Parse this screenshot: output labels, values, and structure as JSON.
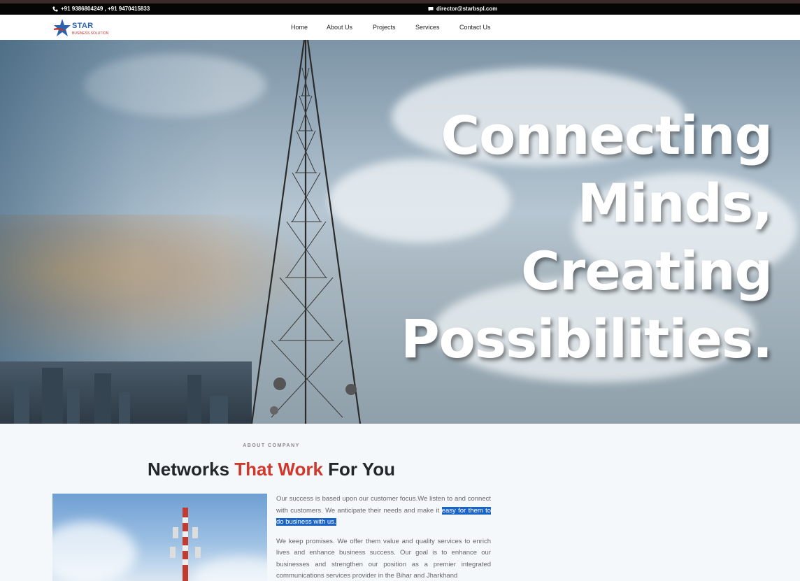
{
  "topbar": {
    "phone_icon": "phone-icon",
    "phone": "+91 9386804249 , +91 9470415833",
    "mail_icon": "message-icon",
    "email": "director@starbspl.com"
  },
  "brand": {
    "logo_icon": "star-logo-icon",
    "name": "STAR",
    "tagline": "BUSINESS SOLUTION",
    "colors": {
      "blue": "#2a63b0",
      "red": "#c0342b"
    }
  },
  "nav": {
    "home": "Home",
    "about": "About Us",
    "projects": "Projects",
    "services": "Services",
    "contact": "Contact Us"
  },
  "hero": {
    "line1": "Connecting",
    "line2": "Minds,",
    "line3": "Creating",
    "line4": "Possibilities."
  },
  "about": {
    "eyebrow": "ABOUT COMPANY",
    "title_start": "Networks ",
    "title_accent": "That Work",
    "title_end": " For You",
    "accent_color": "#d0382b",
    "para1_start": "Our success is based upon our customer focus.We listen to and connect with customers. We anticipate their needs and make it ",
    "para1_highlight": "easy for them to do business with us.",
    "para2": "We keep promises. We offer them value and quality services to enrich lives and enhance business success. Our goal is to enhance our businesses and strengthen our position as a premier integrated communications services provider in the Bihar and Jharkhand"
  }
}
